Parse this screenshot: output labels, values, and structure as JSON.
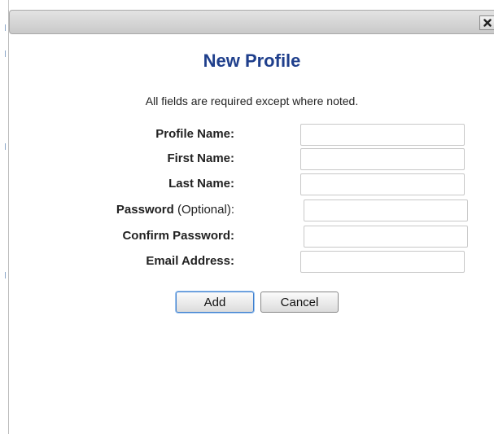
{
  "dialog": {
    "close_label": "x",
    "title": "New Profile",
    "instructions": "All fields are required except where noted."
  },
  "form": {
    "fields": [
      {
        "label": "Profile Name:",
        "optional_label": "",
        "value": ""
      },
      {
        "label": "First Name:",
        "optional_label": "",
        "value": ""
      },
      {
        "label": "Last Name:",
        "optional_label": "",
        "value": ""
      },
      {
        "label": "Password",
        "optional_label": " (Optional):",
        "value": ""
      },
      {
        "label": "Confirm Password:",
        "optional_label": "",
        "value": ""
      },
      {
        "label": "Email Address:",
        "optional_label": "",
        "value": ""
      }
    ]
  },
  "buttons": {
    "add": "Add",
    "cancel": "Cancel"
  },
  "icons": {
    "close": "close-icon"
  }
}
